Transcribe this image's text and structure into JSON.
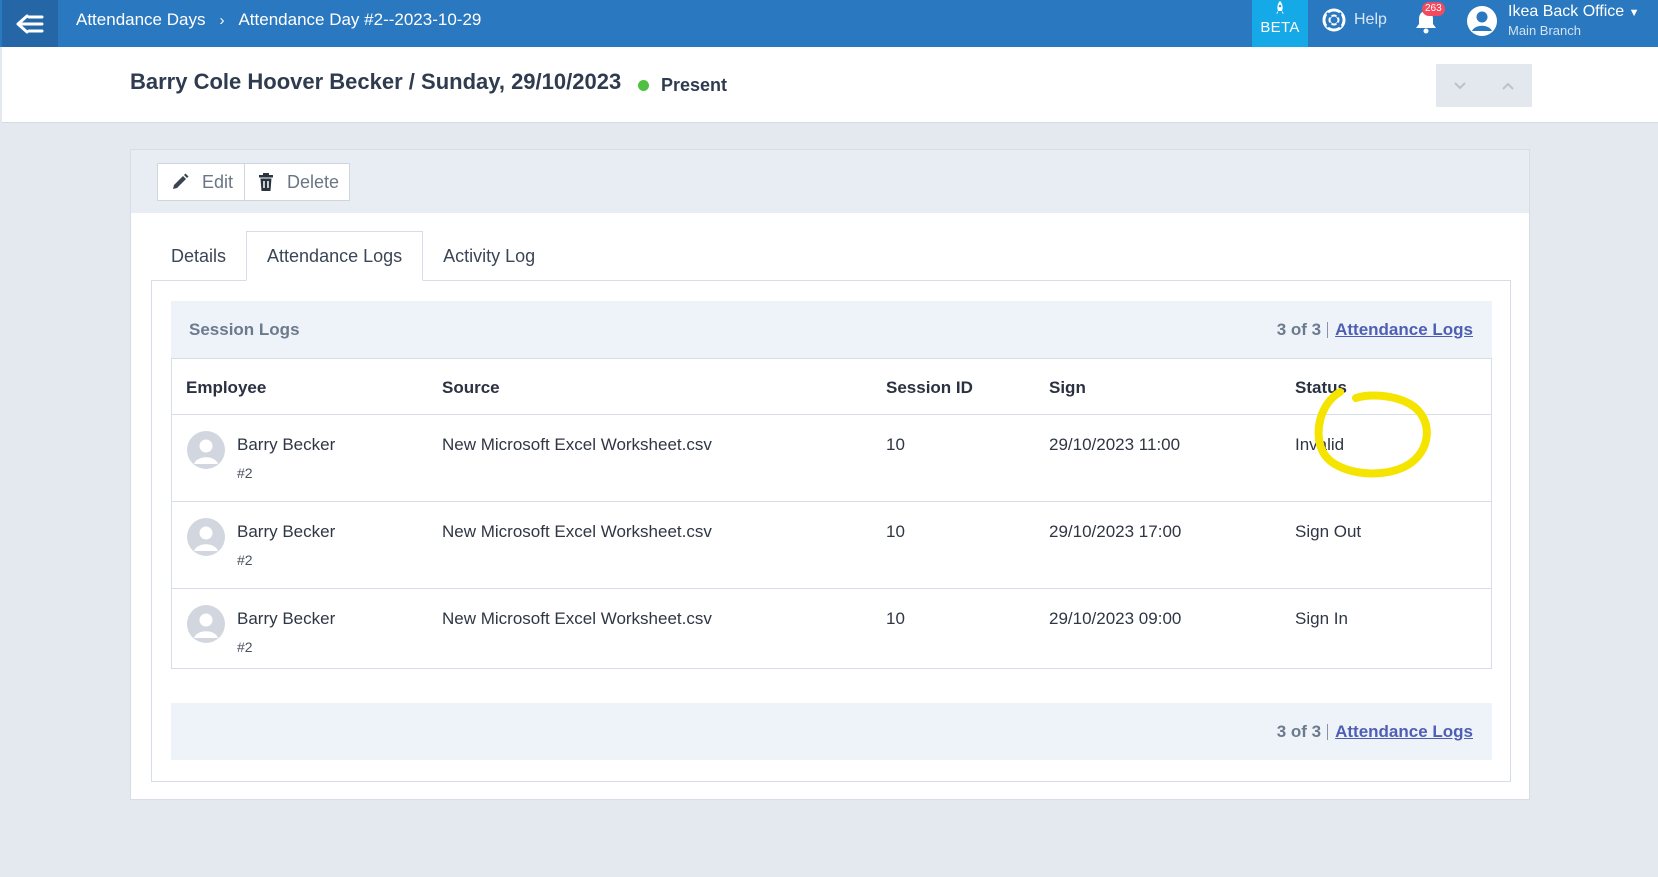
{
  "topbar": {
    "breadcrumbs": [
      "Attendance Days",
      "Attendance Day #2--2023-10-29"
    ],
    "beta_label": "BETA",
    "help_label": "Help",
    "notification_count": "263",
    "user_name": "Ikea Back Office",
    "branch": "Main Branch",
    "colors": {
      "bar": "#2a78bf",
      "beta": "#15a9e8",
      "badge": "#f24b5f"
    }
  },
  "header": {
    "title": "Barry Cole Hoover Becker / Sunday, 29/10/2023",
    "status": "Present",
    "status_color": "#4fc142"
  },
  "toolbar": {
    "edit_label": "Edit",
    "delete_label": "Delete"
  },
  "tabs": [
    {
      "label": "Details"
    },
    {
      "label": "Attendance Logs",
      "active": true
    },
    {
      "label": "Activity Log"
    }
  ],
  "session_logs": {
    "title": "Session Logs",
    "pager_count": "3 of 3",
    "pager_link": "Attendance Logs",
    "columns": [
      "Employee",
      "Source",
      "Session ID",
      "Sign",
      "Status"
    ],
    "rows": [
      {
        "employee": "Barry Becker",
        "employee_id": "#2",
        "source": "New Microsoft Excel Worksheet.csv",
        "session_id": "10",
        "sign": "29/10/2023 11:00",
        "status": "Invalid"
      },
      {
        "employee": "Barry Becker",
        "employee_id": "#2",
        "source": "New Microsoft Excel Worksheet.csv",
        "session_id": "10",
        "sign": "29/10/2023 17:00",
        "status": "Sign Out"
      },
      {
        "employee": "Barry Becker",
        "employee_id": "#2",
        "source": "New Microsoft Excel Worksheet.csv",
        "session_id": "10",
        "sign": "29/10/2023 09:00",
        "status": "Sign In"
      }
    ]
  },
  "annotation_color": "#f5e400"
}
